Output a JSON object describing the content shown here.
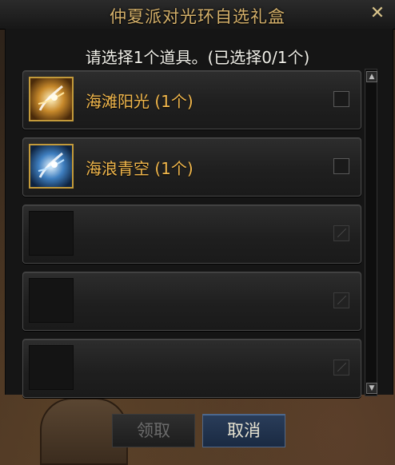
{
  "dialog": {
    "title": "仲夏派对光环自选礼盒",
    "close_label": "✕",
    "prompt": "请选择1个道具。(已选择0/1个)"
  },
  "items": [
    {
      "name": "海滩阳光 (1个)",
      "icon": "beach-sunshine-aura-icon",
      "enabled": true
    },
    {
      "name": "海浪青空 (1个)",
      "icon": "ocean-sky-aura-icon",
      "enabled": true
    },
    {
      "name": "",
      "icon": "empty-slot",
      "enabled": false
    },
    {
      "name": "",
      "icon": "empty-slot",
      "enabled": false
    },
    {
      "name": "",
      "icon": "empty-slot",
      "enabled": false
    }
  ],
  "scroll": {
    "up": "▲",
    "down": "▼"
  },
  "buttons": {
    "receive": "领取",
    "cancel": "取消"
  },
  "colors": {
    "title": "#d4b06a",
    "item_name": "#f0b64b",
    "cancel_button": "#1f3350"
  }
}
